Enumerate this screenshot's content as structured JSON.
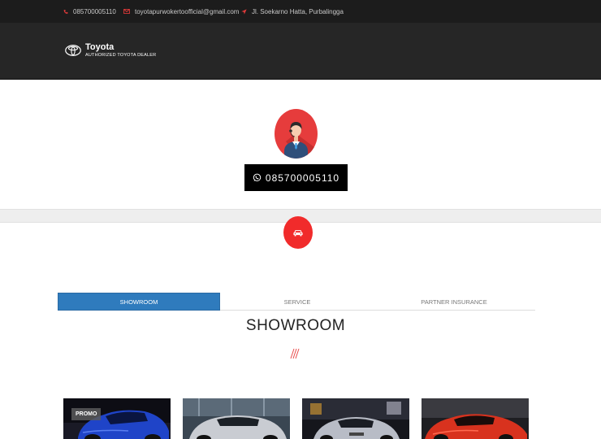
{
  "topbar": {
    "phone": "085700005110",
    "email": "toyotapurwokertoofficial@gmail.com",
    "address": "Jl. Soekarno Hatta, Purbalingga"
  },
  "brand": {
    "title": "Toyota",
    "subtitle": "AUTHORIZED TOYOTA DEALER"
  },
  "contact": {
    "whatsapp_label": "085700005110"
  },
  "tabs": [
    {
      "label": "SHOWROOM",
      "active": true
    },
    {
      "label": "SERVICE",
      "active": false
    },
    {
      "label": "PARTNER INSURANCE",
      "active": false
    }
  ],
  "section": {
    "title": "SHOWROOM"
  },
  "cards": [
    {
      "badge": "PROMO"
    },
    {
      "badge": ""
    },
    {
      "badge": ""
    },
    {
      "badge": ""
    }
  ],
  "colors": {
    "accent": "#e63c3c",
    "tab_active": "#2f7bbd",
    "topbar": "#1c1c1c",
    "header": "#262626"
  }
}
